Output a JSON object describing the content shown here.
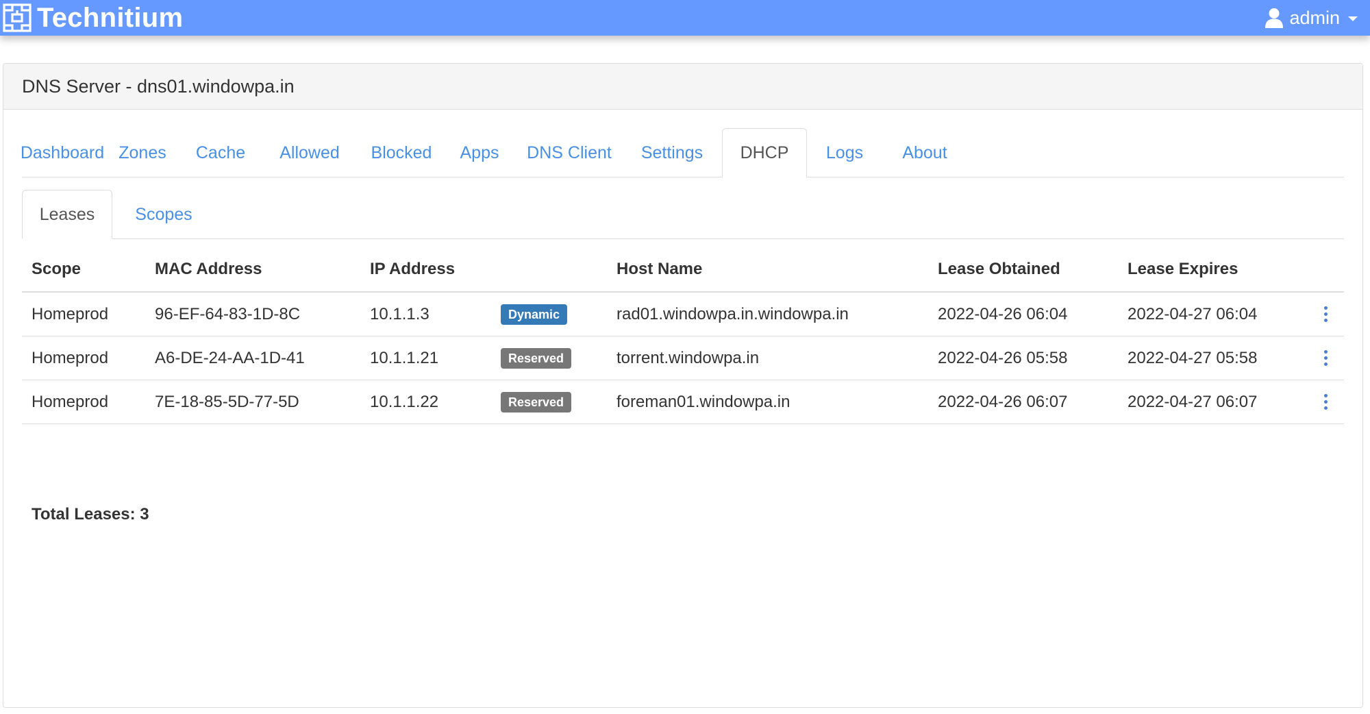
{
  "navbar": {
    "brand": "Technitium",
    "brand_logo_icon": "technitium-logo-icon",
    "user_icon": "user-icon",
    "user": "admin",
    "color": "#6699ff"
  },
  "panel": {
    "title": "DNS Server - dns01.windowpa.in"
  },
  "main_tabs": [
    {
      "label": "Dashboard"
    },
    {
      "label": "Zones"
    },
    {
      "label": "Cache"
    },
    {
      "label": "Allowed"
    },
    {
      "label": "Blocked"
    },
    {
      "label": "Apps"
    },
    {
      "label": "DNS Client"
    },
    {
      "label": "Settings"
    },
    {
      "label": "DHCP",
      "active": true
    },
    {
      "label": "Logs"
    },
    {
      "label": "About"
    }
  ],
  "sub_tabs": [
    {
      "label": "Leases",
      "active": true
    },
    {
      "label": "Scopes"
    }
  ],
  "table": {
    "headers": {
      "scope": "Scope",
      "mac": "MAC Address",
      "ip": "IP Address",
      "host": "Host Name",
      "obtained": "Lease Obtained",
      "expires": "Lease Expires"
    },
    "rows": [
      {
        "scope": "Homeprod",
        "mac": "96-EF-64-83-1D-8C",
        "ip": "10.1.1.3",
        "type": "Dynamic",
        "host": "rad01.windowpa.in.windowpa.in",
        "obtained": "2022-04-26 06:04",
        "expires": "2022-04-27 06:04"
      },
      {
        "scope": "Homeprod",
        "mac": "A6-DE-24-AA-1D-41",
        "ip": "10.1.1.21",
        "type": "Reserved",
        "host": "torrent.windowpa.in",
        "obtained": "2022-04-26 05:58",
        "expires": "2022-04-27 05:58"
      },
      {
        "scope": "Homeprod",
        "mac": "7E-18-85-5D-77-5D",
        "ip": "10.1.1.22",
        "type": "Reserved",
        "host": "foreman01.windowpa.in",
        "obtained": "2022-04-26 06:07",
        "expires": "2022-04-27 06:07"
      }
    ],
    "total_label": "Total Leases: 3",
    "badge_colors": {
      "Dynamic": "#337ab7",
      "Reserved": "#777777"
    },
    "row_menu_icon": "kebab-menu-icon"
  }
}
